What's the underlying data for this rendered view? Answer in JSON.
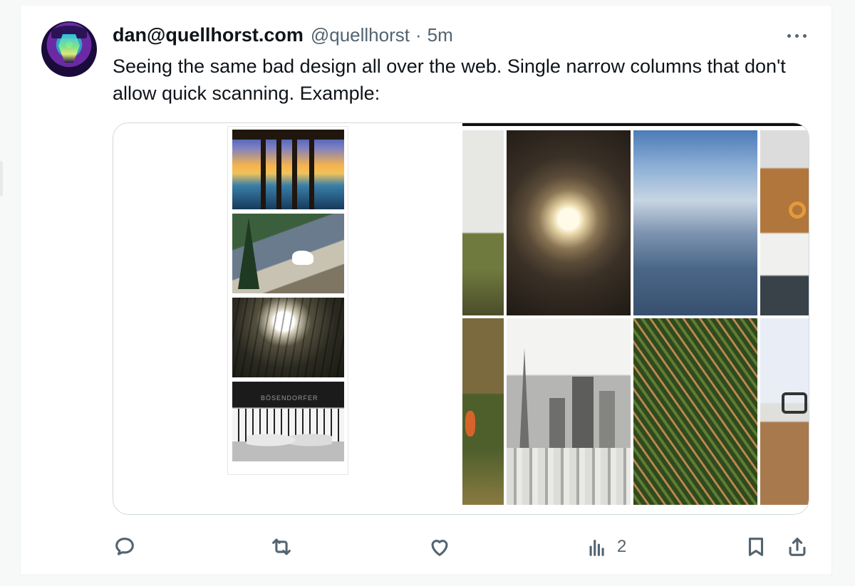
{
  "tweet": {
    "display_name": "dan@quellhorst.com",
    "handle": "@quellhorst",
    "separator": "·",
    "time": "5m",
    "text": "Seeing the same bad design all over the web. Single narrow columns that don't allow quick scanning. Example:",
    "avatar_icon": "avatar-image"
  },
  "media": {
    "left_column_images": [
      "pier-sunset-photo",
      "mountain-goat-photo",
      "light-shaft-photo",
      "piano-hands-photo"
    ],
    "piano_text": "BÖSENDORFER",
    "grid_images": [
      "hillside-photo",
      "tunnel-light-photo",
      "mountain-clouds-photo",
      "sailboat-photo",
      "flower-field-photo",
      "city-skyline-photo",
      "farm-field-aerial-photo",
      "desk-glasses-photo"
    ]
  },
  "actions": {
    "reply_icon": "reply-icon",
    "retweet_icon": "retweet-icon",
    "like_icon": "like-icon",
    "views_icon": "views-icon",
    "views_count": "2",
    "bookmark_icon": "bookmark-icon",
    "share_icon": "share-icon"
  },
  "colors": {
    "text_primary": "#0f1419",
    "text_secondary": "#536471",
    "border": "#cfd9de"
  }
}
